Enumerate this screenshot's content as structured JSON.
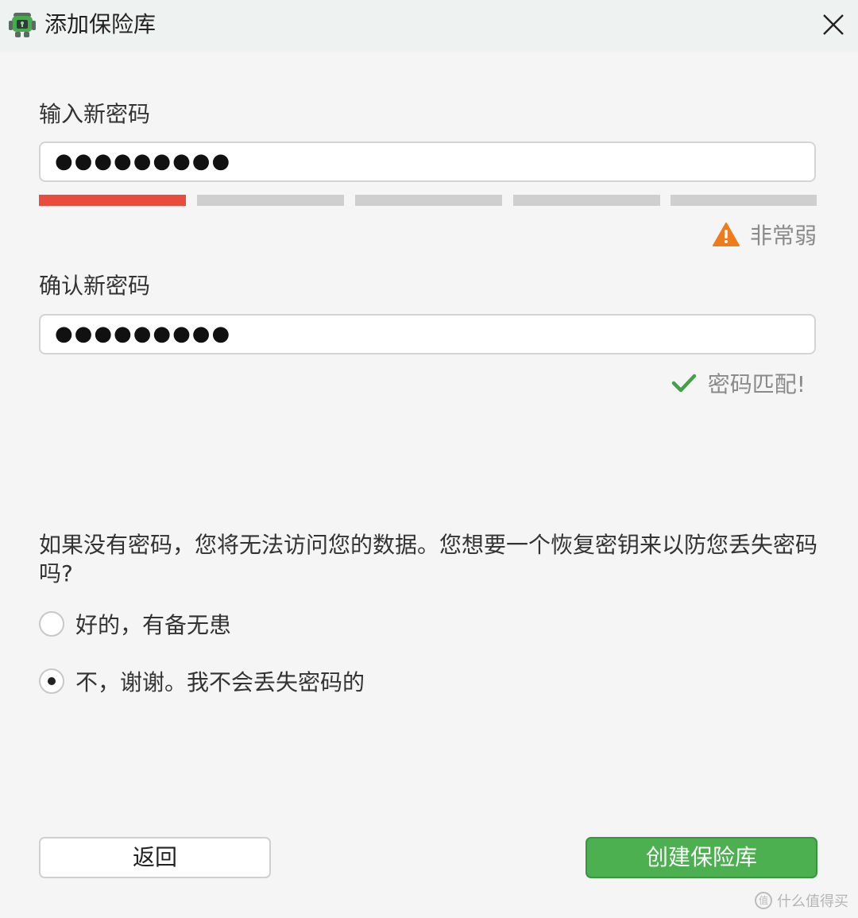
{
  "window": {
    "title": "添加保险库",
    "close_icon": "close-icon"
  },
  "password": {
    "label": "输入新密码",
    "masked_value": "●●●●●●●●●",
    "strength": {
      "segments_total": 5,
      "segments_filled": 1,
      "filled_color": "#e74c3c",
      "empty_color": "#cfcfcf",
      "warning_icon": "warning-triangle-icon",
      "warning_color": "#ef7b1a",
      "text": "非常弱"
    }
  },
  "confirm": {
    "label": "确认新密码",
    "masked_value": "●●●●●●●●●",
    "match_icon": "checkmark-icon",
    "match_color": "#43a047",
    "match_text": "密码匹配!"
  },
  "recovery": {
    "question": "如果没有密码，您将无法访问您的数据。您想要一个恢复密钥来以防您丢失密码吗?",
    "options": [
      {
        "label": "好的，有备无患",
        "selected": false
      },
      {
        "label": "不，谢谢。我不会丢失密码的",
        "selected": true
      }
    ]
  },
  "buttons": {
    "back": "返回",
    "create": "创建保险库",
    "create_color": "#4caf50"
  },
  "watermark": {
    "text": "什么值得买",
    "badge": "值"
  }
}
